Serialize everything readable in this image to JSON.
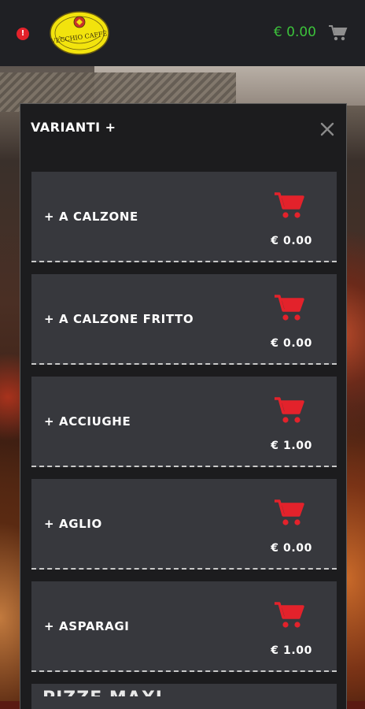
{
  "header": {
    "notification_badge": "!",
    "logo_text": "VECCHIO CAFFÈ",
    "cart_total": "€ 0.00",
    "cart_icon": "shopping-cart-icon"
  },
  "modal": {
    "title": "VARIANTI +",
    "close_icon": "close-icon",
    "items": [
      {
        "name": "+ A CALZONE",
        "price": "€ 0.00"
      },
      {
        "name": "+ A CALZONE FRITTO",
        "price": "€ 0.00"
      },
      {
        "name": "+ ACCIUGHE",
        "price": "€ 1.00"
      },
      {
        "name": "+ AGLIO",
        "price": "€ 0.00"
      },
      {
        "name": "+ ASPARAGI",
        "price": "€ 1.00"
      }
    ],
    "partial_item_label": "PIZZE MAXI"
  },
  "colors": {
    "accent_red": "#e3222b",
    "total_green": "#3cc23b",
    "item_bg": "#37383d",
    "modal_bg": "#1c1c1e"
  }
}
